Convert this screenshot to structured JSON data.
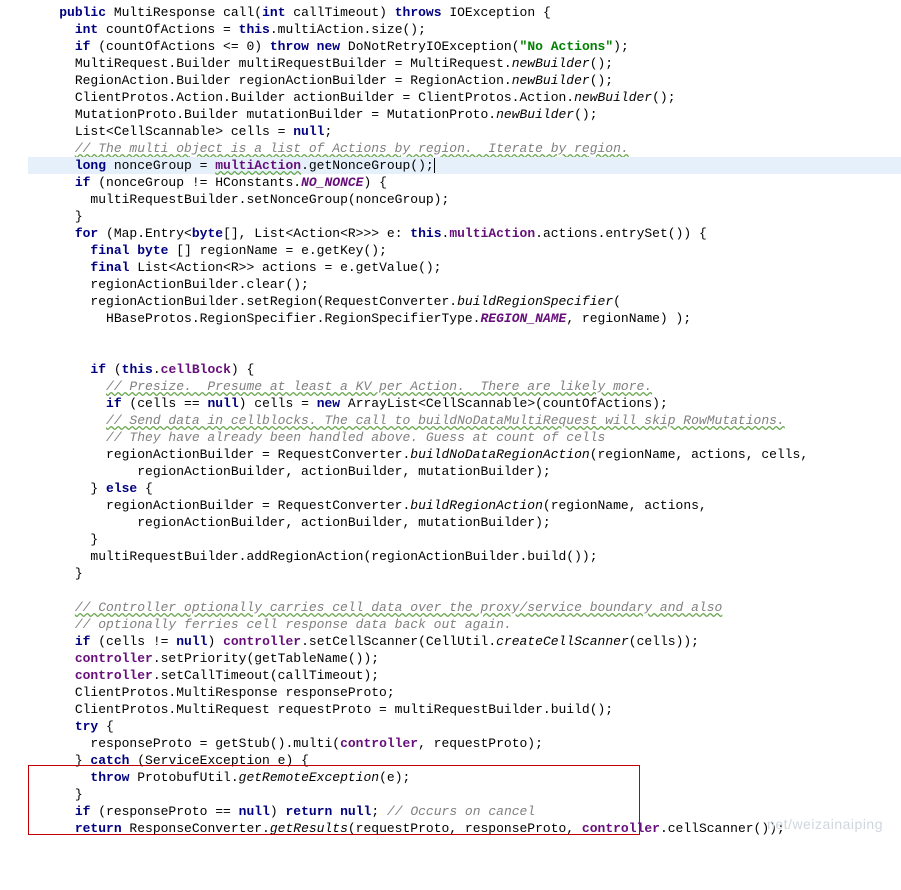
{
  "lines": {
    "l1_public": "public",
    "l1_ret": " MultiResponse ",
    "l1_call": "call",
    "l1_sig1": "(",
    "l1_int": "int",
    "l1_sig2": " callTimeout) ",
    "l1_throws": "throws",
    "l1_ex": " IOException {",
    "l2_int": "int",
    "l2_var": " countOfActions = ",
    "l2_this": "this",
    "l2_rest": ".multiAction.size();",
    "l3_if": "if",
    "l3_cond": " (countOfActions <= 0) ",
    "l3_throw": "throw",
    "l3_new": " new",
    "l3_ex": " DoNotRetryIOException(",
    "l3_str": "\"No Actions\"",
    "l3_end": ");",
    "l4_a": "MultiRequest.Builder multiRequestBuilder = MultiRequest.",
    "l4_m": "newBuilder",
    "l4_e": "();",
    "l5_a": "RegionAction.Builder regionActionBuilder = RegionAction.",
    "l5_m": "newBuilder",
    "l5_e": "();",
    "l6_a": "ClientProtos.Action.Builder actionBuilder = ClientProtos.Action.",
    "l6_m": "newBuilder",
    "l6_e": "();",
    "l7_a": "MutationProto.Builder mutationBuilder = MutationProto.",
    "l7_m": "newBuilder",
    "l7_e": "();",
    "l8_a": "List<CellScannable> cells = ",
    "l8_null": "null",
    "l8_e": ";",
    "l9": "// The multi object is a list of Actions by region.  Iterate by region.",
    "l10_long": "long",
    "l10_a": " nonceGroup = ",
    "l10_m": "multiAction",
    "l10_b": ".getNonceGroup();",
    "l11_if": "if",
    "l11_a": " (nonceGroup != HConstants.",
    "l11_f": "NO_NONCE",
    "l11_e": ") {",
    "l12": "multiRequestBuilder.setNonceGroup(nonceGroup);",
    "l13": "}",
    "l14_for": "for",
    "l14_a": " (Map.Entry<",
    "l14_byte": "byte",
    "l14_b": "[], List<Action<R>>> e: ",
    "l14_this": "this",
    "l14_c": ".",
    "l14_f": "multiAction",
    "l14_d": ".actions.entrySet()) {",
    "l15_final": "final",
    "l15_byte": " byte",
    "l15_a": " [] regionName = e.getKey();",
    "l16_final": "final",
    "l16_a": " List<Action<R>> actions = e.getValue();",
    "l17": "regionActionBuilder.clear();",
    "l18_a": "regionActionBuilder.setRegion(RequestConverter.",
    "l18_m": "buildRegionSpecifier",
    "l18_e": "(",
    "l19_a": "HBaseProtos.RegionSpecifier.RegionSpecifierType.",
    "l19_f": "REGION_NAME",
    "l19_e": ", regionName) );",
    "l20_if": "if",
    "l20_a": " (",
    "l20_this": "this",
    "l20_b": ".",
    "l20_f": "cellBlock",
    "l20_e": ") {",
    "l21": "// Presize.  Presume at least a KV per Action.  There are likely more.",
    "l22_if": "if",
    "l22_a": " (cells == ",
    "l22_null": "null",
    "l22_b": ") cells = ",
    "l22_new": "new",
    "l22_c": " ArrayList<CellScannable>(countOfActions);",
    "l23": "// Send data in cellblocks. The call to buildNoDataMultiRequest will skip RowMutations.",
    "l24": "// They have already been handled above. Guess at count of cells",
    "l25_a": "regionActionBuilder = RequestConverter.",
    "l25_m": "buildNoDataRegionAction",
    "l25_e": "(regionName, actions, cells,",
    "l26": "regionActionBuilder, actionBuilder, mutationBuilder);",
    "l27_a": "} ",
    "l27_else": "else",
    "l27_b": " {",
    "l28_a": "regionActionBuilder = RequestConverter.",
    "l28_m": "buildRegionAction",
    "l28_e": "(regionName, actions,",
    "l29": "regionActionBuilder, actionBuilder, mutationBuilder);",
    "l30": "}",
    "l31": "multiRequestBuilder.addRegionAction(regionActionBuilder.build());",
    "l32": "}",
    "l33": "// Controller optionally carries cell data over the proxy/service boundary and also",
    "l34": "// optionally ferries cell response data back out again.",
    "l35_if": "if",
    "l35_a": " (cells != ",
    "l35_null": "null",
    "l35_b": ") ",
    "l35_f": "controller",
    "l35_c": ".setCellScanner(CellUtil.",
    "l35_m": "createCellScanner",
    "l35_e": "(cells));",
    "l36_f": "controller",
    "l36_a": ".setPriority(getTableName());",
    "l37_f": "controller",
    "l37_a": ".setCallTimeout(callTimeout);",
    "l38": "ClientProtos.MultiResponse responseProto;",
    "l39": "ClientProtos.MultiRequest requestProto = multiRequestBuilder.build();",
    "l40_try": "try",
    "l40_a": " {",
    "l41_a": "responseProto = getStub().multi(",
    "l41_f": "controller",
    "l41_b": ", requestProto);",
    "l42_a": "} ",
    "l42_catch": "catch",
    "l42_b": " (ServiceException e) {",
    "l43_throw": "throw",
    "l43_a": " ProtobufUtil.",
    "l43_m": "getRemoteException",
    "l43_e": "(e);",
    "l44": "}",
    "l45_if": "if",
    "l45_a": " (responseProto == ",
    "l45_null": "null",
    "l45_b": ") ",
    "l45_ret": "return",
    "l45_null2": " null",
    "l45_c": "; ",
    "l45_cmt": "// Occurs on cancel",
    "l46_ret": "return",
    "l46_a": " ResponseConverter.",
    "l46_m": "getResults",
    "l46_b": "(requestProto, responseProto, ",
    "l46_f": "controller",
    "l46_c": ".cellScanner());"
  },
  "watermark": "net/weizainaiping"
}
